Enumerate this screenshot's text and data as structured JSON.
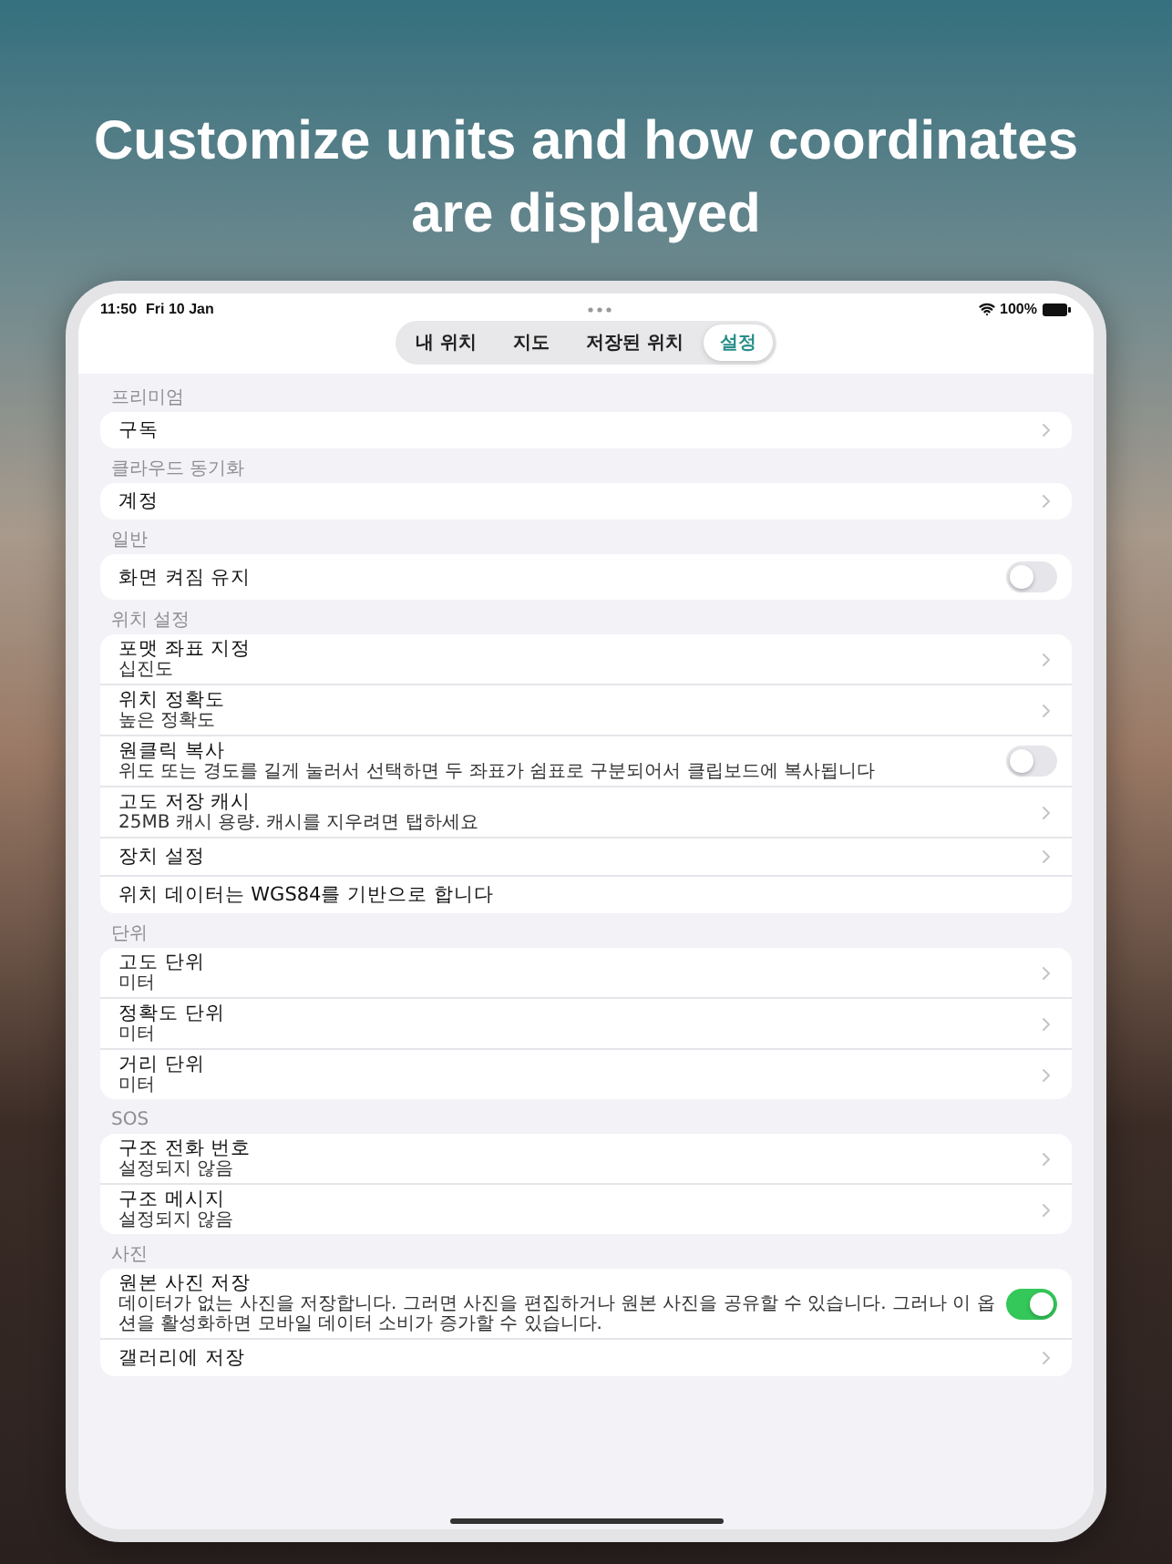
{
  "headline": "Customize units and how coordinates are displayed",
  "status_bar": {
    "time": "11:50",
    "date": "Fri 10 Jan",
    "battery": "100%"
  },
  "tabs": [
    {
      "label": "내 위치",
      "selected": false
    },
    {
      "label": "지도",
      "selected": false
    },
    {
      "label": "저장된 위치",
      "selected": false
    },
    {
      "label": "설정",
      "selected": true
    }
  ],
  "sections": [
    {
      "header": "프리미엄",
      "rows": [
        {
          "kind": "chevron",
          "title": "구독"
        }
      ]
    },
    {
      "header": "클라우드 동기화",
      "rows": [
        {
          "kind": "chevron",
          "title": "계정"
        }
      ]
    },
    {
      "header": "일반",
      "rows": [
        {
          "kind": "toggle",
          "title": "화면 켜짐 유지",
          "on": false
        }
      ]
    },
    {
      "header": "위치 설정",
      "rows": [
        {
          "kind": "chevron",
          "title": "포맷 좌표 지정",
          "subtitle": "십진도"
        },
        {
          "kind": "chevron",
          "title": "위치 정확도",
          "subtitle": "높은 정확도"
        },
        {
          "kind": "toggle",
          "title": "원클릭 복사",
          "subtitle": "위도 또는 경도를 길게 눌러서 선택하면 두 좌표가 쉼표로 구분되어서 클립보드에 복사됩니다",
          "on": false
        },
        {
          "kind": "chevron",
          "title": "고도 저장 캐시",
          "subtitle": "25MB 캐시 용량. 캐시를 지우려면 탭하세요"
        },
        {
          "kind": "chevron",
          "title": "장치 설정"
        },
        {
          "kind": "plain",
          "title": "위치 데이터는 WGS84를 기반으로 합니다"
        }
      ]
    },
    {
      "header": "단위",
      "rows": [
        {
          "kind": "chevron",
          "title": "고도 단위",
          "subtitle": "미터"
        },
        {
          "kind": "chevron",
          "title": "정확도 단위",
          "subtitle": "미터"
        },
        {
          "kind": "chevron",
          "title": "거리 단위",
          "subtitle": "미터"
        }
      ]
    },
    {
      "header": "SOS",
      "rows": [
        {
          "kind": "chevron",
          "title": "구조 전화 번호",
          "subtitle": "설정되지 않음"
        },
        {
          "kind": "chevron",
          "title": "구조 메시지",
          "subtitle": "설정되지 않음"
        }
      ]
    },
    {
      "header": "사진",
      "rows": [
        {
          "kind": "toggle",
          "title": "원본 사진 저장",
          "subtitle": "데이터가 없는 사진을 저장합니다. 그러면 사진을 편집하거나 원본 사진을 공유할 수 있습니다. 그러나 이 옵션을 활성화하면 모바일 데이터 소비가 증가할 수 있습니다.",
          "on": true
        },
        {
          "kind": "chevron",
          "title": "갤러리에 저장"
        }
      ]
    }
  ]
}
